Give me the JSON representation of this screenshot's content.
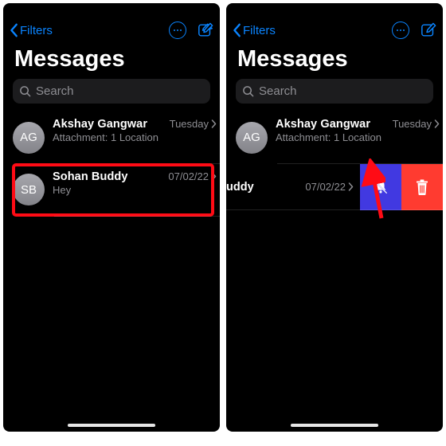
{
  "nav": {
    "back_label": "Filters"
  },
  "title": "Messages",
  "search": {
    "placeholder": "Search"
  },
  "left": {
    "rows": [
      {
        "initials": "AG",
        "name": "Akshay  Gangwar",
        "stamp": "Tuesday",
        "preview": "Attachment: 1 Location"
      },
      {
        "initials": "SB",
        "name": "Sohan Buddy",
        "stamp": "07/02/22",
        "preview": "Hey"
      }
    ]
  },
  "right": {
    "rows": [
      {
        "initials": "AG",
        "name": "Akshay  Gangwar",
        "stamp": "Tuesday",
        "preview": "Attachment: 1 Location"
      }
    ],
    "swiped": {
      "name_stub": "uddy",
      "stamp": "07/02/22"
    }
  }
}
